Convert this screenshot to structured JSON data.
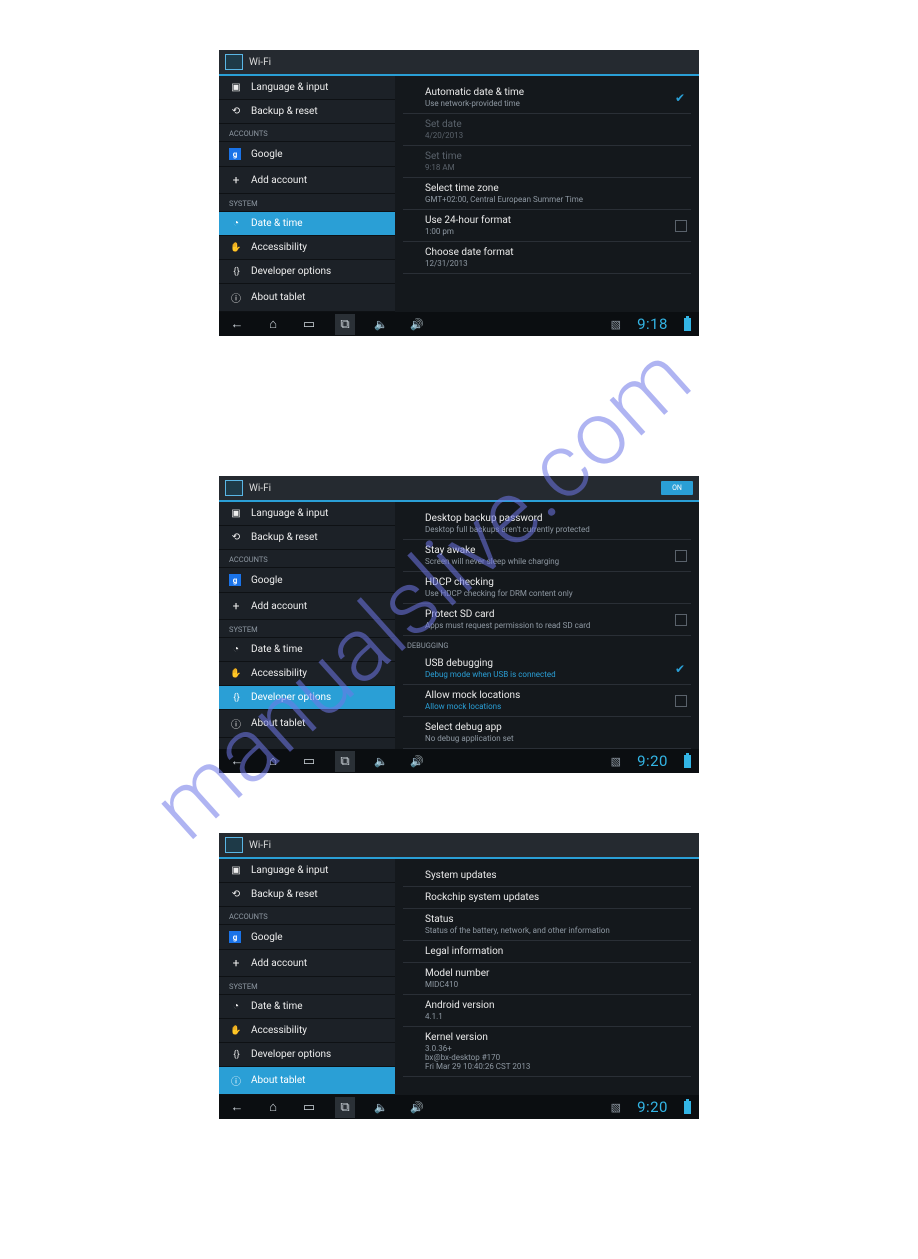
{
  "watermark": "manualslive.com",
  "sidebar": {
    "lang_input": "Language & input",
    "backup_reset": "Backup & reset",
    "hdr_accounts": "ACCOUNTS",
    "google": "Google",
    "add_account": "Add account",
    "hdr_system": "SYSTEM",
    "date_time": "Date & time",
    "accessibility": "Accessibility",
    "dev_options": "Developer options",
    "about_tablet": "About tablet"
  },
  "ab_title": "Wi-Fi",
  "toggle_on": "ON",
  "shot1": {
    "auto_dt": "Automatic date & time",
    "auto_dt_sub": "Use network-provided time",
    "set_date": "Set date",
    "set_date_sub": "4/20/2013",
    "set_time": "Set time",
    "set_time_sub": "9:18 AM",
    "tz": "Select time zone",
    "tz_sub": "GMT+02:00, Central European Summer Time",
    "h24": "Use 24-hour format",
    "h24_sub": "1:00 pm",
    "date_fmt": "Choose date format",
    "date_fmt_sub": "12/31/2013",
    "clock": "9:18"
  },
  "shot2": {
    "bkp_pw": "Desktop backup password",
    "bkp_pw_sub": "Desktop full backups aren't currently protected",
    "stay_awake": "Stay awake",
    "stay_awake_sub": "Screen will never sleep while charging",
    "hdcp": "HDCP checking",
    "hdcp_sub": "Use HDCP checking for DRM content only",
    "protect_sd": "Protect SD card",
    "protect_sd_sub": "Apps must request permission to read SD card",
    "hdr_debug": "DEBUGGING",
    "usb_dbg": "USB debugging",
    "usb_dbg_sub": "Debug mode when USB is connected",
    "mock_loc": "Allow mock locations",
    "mock_loc_sub": "Allow mock locations",
    "sel_dbg": "Select debug app",
    "sel_dbg_sub": "No debug application set",
    "clock": "9:20"
  },
  "shot3": {
    "sys_upd": "System updates",
    "rk_upd": "Rockchip system updates",
    "status": "Status",
    "status_sub": "Status of the battery, network, and other information",
    "legal": "Legal information",
    "model": "Model number",
    "model_sub": "MIDC410",
    "andr": "Android version",
    "andr_sub": "4.1.1",
    "kernel": "Kernel version",
    "kernel_sub": "3.0.36+\nbx@bx-desktop #170\nFri Mar 29 10:40:26 CST 2013",
    "clock": "9:20"
  }
}
